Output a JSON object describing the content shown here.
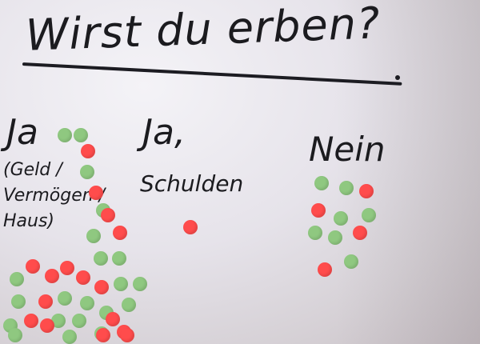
{
  "title": "Wirst du erben?",
  "columns": [
    {
      "label": "Ja",
      "sublabel": "(Geld /\nVermögen /\nHaus)"
    },
    {
      "label": "Ja,",
      "sublabel": "Schulden"
    },
    {
      "label": "Nein",
      "sublabel": ""
    }
  ],
  "colors": {
    "green_dot": "#8fc880",
    "red_dot": "#ff4c4c"
  }
}
